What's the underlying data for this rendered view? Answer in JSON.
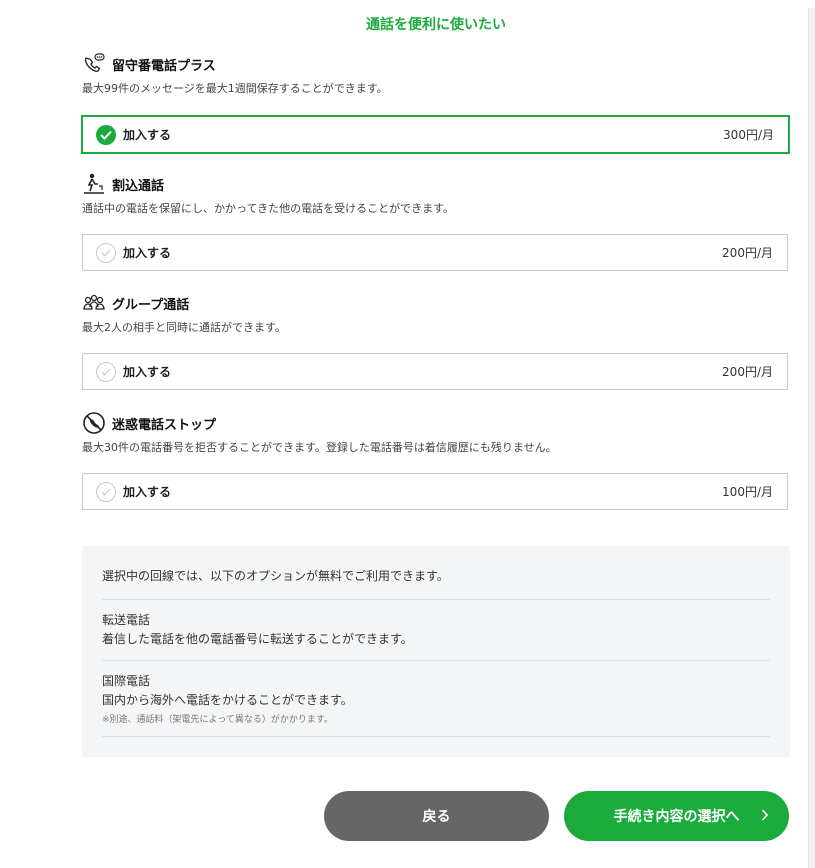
{
  "page_title": "通話を便利に使いたい",
  "sections": [
    {
      "title": "留守番電話プラス",
      "icon": "voicemail-phone-icon",
      "desc": "最大99件のメッセージを最大1週間保存することができます。",
      "option_label": "加入する",
      "price": "300円/月",
      "selected": true
    },
    {
      "title": "割込通話",
      "icon": "call-waiting-icon",
      "desc": "通話中の電話を保留にし、かかってきた他の電話を受けることができます。",
      "option_label": "加入する",
      "price": "200円/月",
      "selected": false
    },
    {
      "title": "グループ通話",
      "icon": "group-people-icon",
      "desc": "最大2人の相手と同時に通話ができます。",
      "option_label": "加入する",
      "price": "200円/月",
      "selected": false
    },
    {
      "title": "迷惑電話ストップ",
      "icon": "blocked-phone-icon",
      "desc": "最大30件の電話番号を拒否することができます。登録した電話番号は着信履歴にも残りません。",
      "option_label": "加入する",
      "price": "100円/月",
      "selected": false
    }
  ],
  "info": {
    "heading": "選択中の回線では、以下のオプションが無料でご利用できます。",
    "items": [
      {
        "title": "転送電話",
        "desc": "着信した電話を他の電話番号に転送することができます。",
        "note": ""
      },
      {
        "title": "国際電話",
        "desc": "国内から海外へ電話をかけることができます。",
        "note": "※別途、通話料（架電先によって異なる）がかかります。"
      }
    ]
  },
  "buttons": {
    "back": "戻る",
    "next": "手続き内容の選択へ"
  },
  "colors": {
    "accent": "#1aab3c",
    "back_button": "#666666",
    "info_bg": "#f4f5f6"
  }
}
